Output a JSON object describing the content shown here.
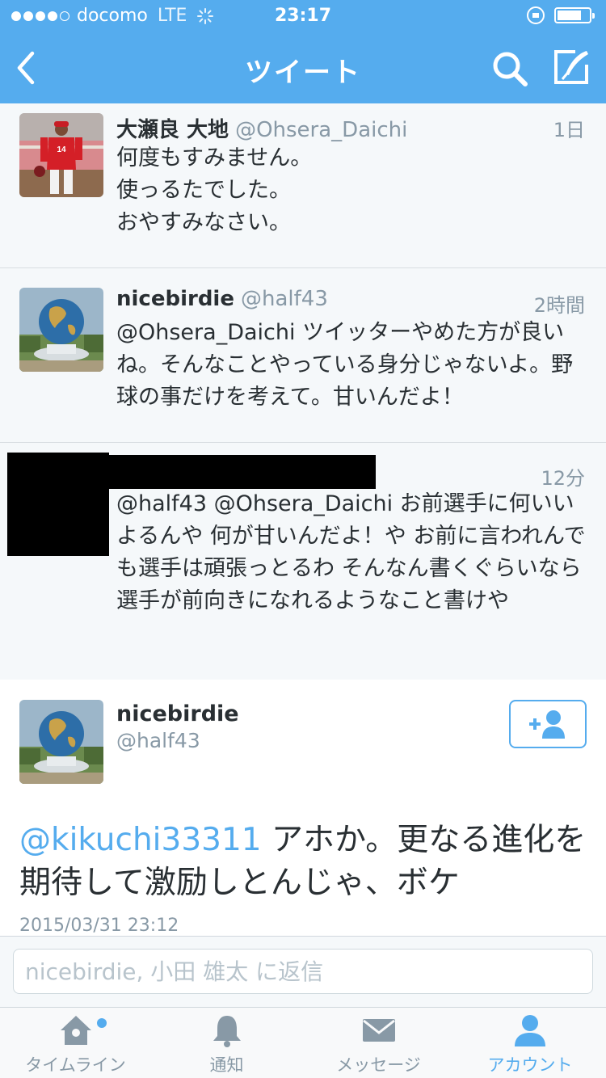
{
  "status_bar": {
    "carrier": "docomo",
    "network": "LTE",
    "time": "23:17",
    "battery_level": 0.75
  },
  "nav": {
    "title": "ツイート"
  },
  "tweets": [
    {
      "name": "大瀬良 大地",
      "handle": "@Ohsera_Daichi",
      "time": "1日",
      "text": "何度もすみません。\n使っるたでした。\nおやすみなさい。"
    },
    {
      "name": "nicebirdie",
      "handle": "@half43",
      "time": "2時間",
      "text": "@Ohsera_Daichi ツイッターやめた方が良いね。そんなことやっている身分じゃないよ。野球の事だけを考えて。甘いんだよ！"
    },
    {
      "name": "",
      "handle": "",
      "time": "12分",
      "text": "@half43 @Ohsera_Daichi お前選手に何いいよるんや 何が甘いんだよ！や お前に言われんでも選手は頑張っとるわ そんなん書くぐらいなら選手が前向きになれるようなこと書けや"
    }
  ],
  "focused": {
    "name": "nicebirdie",
    "handle": "@half43",
    "mention": "@kikuchi33311",
    "text": " アホか。更なる進化を期待して激励しとんじゃ、ボケ",
    "timestamp": "2015/03/31 23:12"
  },
  "reply": {
    "placeholder": "nicebirdie, 小田 雄太 に返信"
  },
  "tabs": [
    {
      "label": "タイムライン",
      "icon": "home-icon",
      "active": false,
      "badge": true
    },
    {
      "label": "通知",
      "icon": "bell-icon",
      "active": false,
      "badge": false
    },
    {
      "label": "メッセージ",
      "icon": "envelope-icon",
      "active": false,
      "badge": false
    },
    {
      "label": "アカウント",
      "icon": "person-icon",
      "active": true,
      "badge": false
    }
  ],
  "colors": {
    "accent": "#55acee",
    "background": "#f5f8fa",
    "muted_text": "#8899a6",
    "text": "#292f33"
  }
}
